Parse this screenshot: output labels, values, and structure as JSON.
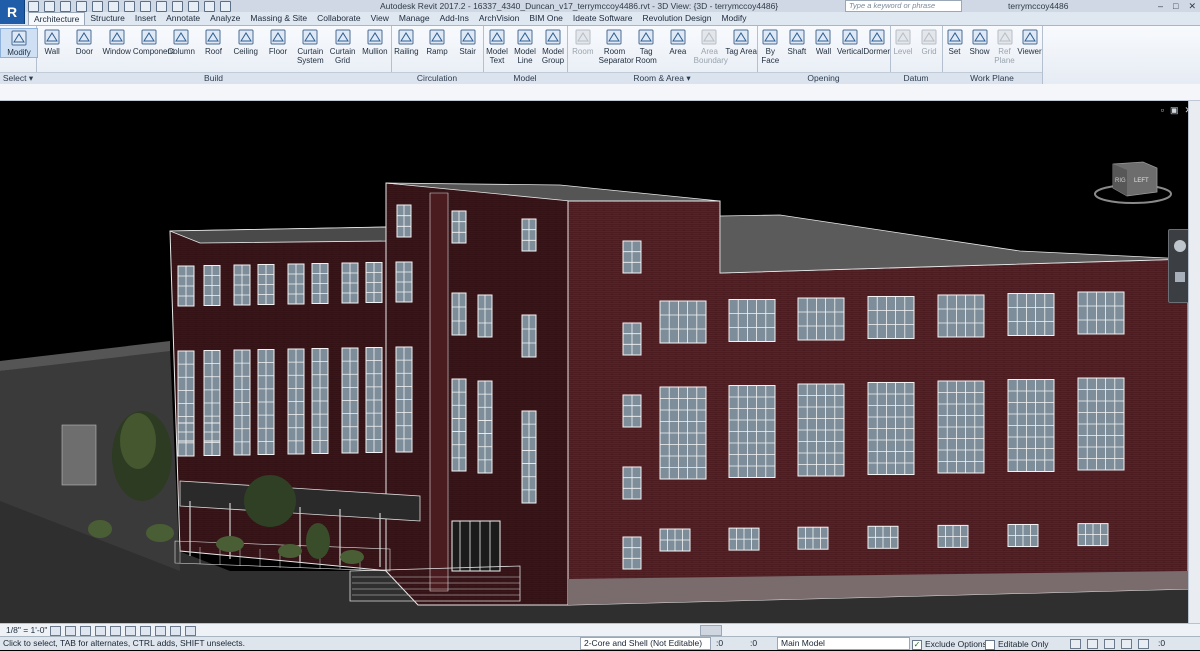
{
  "app": {
    "logo": "R",
    "title": "Autodesk Revit 2017.2 -    16337_4340_Duncan_v17_terrymccoy4486.rvt - 3D View: {3D - terrymccoy4486}",
    "search_placeholder": "Type a keyword or phrase",
    "user": "terrymccoy4486"
  },
  "tabs": [
    "Architecture",
    "Structure",
    "Insert",
    "Annotate",
    "Analyze",
    "Massing & Site",
    "Collaborate",
    "View",
    "Manage",
    "Add-Ins",
    "ArchVision",
    "BIM One",
    "Ideate Software",
    "Revolution Design",
    "Modify"
  ],
  "ribbon": {
    "select": {
      "label": "Select ▾",
      "tools": [
        {
          "label": "Modify",
          "icon": "cursor-icon"
        }
      ]
    },
    "build": {
      "label": "Build",
      "tools": [
        {
          "label": "Wall",
          "icon": "wall-icon"
        },
        {
          "label": "Door",
          "icon": "door-icon"
        },
        {
          "label": "Window",
          "icon": "window-icon"
        },
        {
          "label": "Component",
          "icon": "component-icon"
        },
        {
          "label": "Column",
          "icon": "column-icon"
        },
        {
          "label": "Roof",
          "icon": "roof-icon"
        },
        {
          "label": "Ceiling",
          "icon": "ceiling-icon"
        },
        {
          "label": "Floor",
          "icon": "floor-icon"
        },
        {
          "label": "Curtain System",
          "icon": "curtain-system-icon"
        },
        {
          "label": "Curtain Grid",
          "icon": "curtain-grid-icon"
        },
        {
          "label": "Mullion",
          "icon": "mullion-icon"
        }
      ]
    },
    "circulation": {
      "label": "Circulation",
      "tools": [
        {
          "label": "Railing",
          "icon": "railing-icon"
        },
        {
          "label": "Ramp",
          "icon": "ramp-icon"
        },
        {
          "label": "Stair",
          "icon": "stair-icon"
        }
      ]
    },
    "model": {
      "label": "Model",
      "tools": [
        {
          "label": "Model Text",
          "icon": "model-text-icon"
        },
        {
          "label": "Model Line",
          "icon": "model-line-icon"
        },
        {
          "label": "Model Group",
          "icon": "model-group-icon"
        }
      ]
    },
    "room_area": {
      "label": "Room & Area ▾",
      "tools": [
        {
          "label": "Room",
          "icon": "room-icon",
          "dim": true
        },
        {
          "label": "Room Separator",
          "icon": "room-separator-icon"
        },
        {
          "label": "Tag Room",
          "icon": "tag-room-icon"
        },
        {
          "label": "Area",
          "icon": "area-icon"
        },
        {
          "label": "Area Boundary",
          "icon": "area-boundary-icon",
          "dim": true
        },
        {
          "label": "Tag Area",
          "icon": "tag-area-icon"
        }
      ]
    },
    "opening": {
      "label": "Opening",
      "tools": [
        {
          "label": "By Face",
          "icon": "by-face-icon"
        },
        {
          "label": "Shaft",
          "icon": "shaft-icon"
        },
        {
          "label": "Wall",
          "icon": "wall-opening-icon"
        },
        {
          "label": "Vertical",
          "icon": "vertical-icon"
        },
        {
          "label": "Dormer",
          "icon": "dormer-icon"
        }
      ]
    },
    "datum": {
      "label": "Datum",
      "tools": [
        {
          "label": "Level",
          "icon": "level-icon",
          "dim": true
        },
        {
          "label": "Grid",
          "icon": "grid-icon",
          "dim": true
        }
      ]
    },
    "work_plane": {
      "label": "Work Plane",
      "tools": [
        {
          "label": "Set",
          "icon": "set-icon"
        },
        {
          "label": "Show",
          "icon": "show-icon"
        },
        {
          "label": "Ref Plane",
          "icon": "ref-plane-icon",
          "dim": true
        },
        {
          "label": "Viewer",
          "icon": "viewer-icon"
        }
      ]
    }
  },
  "viewcube": {
    "front": "RIG",
    "side": "LEFT"
  },
  "viewbar": {
    "scale": "1/8\" = 1'-0\""
  },
  "status": {
    "message": "Click to select, TAB for alternates, CTRL adds, SHIFT unselects.",
    "workset": "2-Core and Shell (Not Editable)",
    "count1": ":0",
    "count2": ":0",
    "design_option": "Main Model",
    "exclude_options": "Exclude Options",
    "editable_only": "Editable Only",
    "filter_count": ":0"
  },
  "colors": {
    "brick": "#5a2228",
    "brick_dark": "#3a1418",
    "edge": "#e8e8e8",
    "window": "#f2f2f2",
    "sky": "#000000",
    "roof": "#5b5b5b"
  }
}
